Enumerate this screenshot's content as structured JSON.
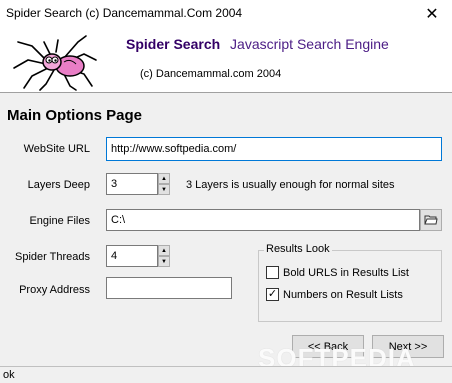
{
  "window": {
    "title": "Spider Search (c) Dancemammal.Com 2004"
  },
  "header": {
    "app_name": "Spider Search",
    "app_subtitle": "Javascript Search Engine",
    "copyright": "(c) Dancemammal.com 2004"
  },
  "page": {
    "title": "Main Options Page"
  },
  "form": {
    "website_url": {
      "label": "WebSite URL",
      "value": "http://www.softpedia.com/"
    },
    "layers_deep": {
      "label": "Layers Deep",
      "value": "3",
      "hint": "3 Layers is usually enough for normal sites"
    },
    "engine_files": {
      "label": "Engine Files",
      "value": "C:\\"
    },
    "spider_threads": {
      "label": "Spider Threads",
      "value": "4"
    },
    "proxy_address": {
      "label": "Proxy Address",
      "value": ""
    }
  },
  "results_look": {
    "title": "Results Look",
    "options": [
      {
        "label": "Bold URLS in Results List",
        "checked": false
      },
      {
        "label": "Numbers on Result Lists",
        "checked": true
      }
    ]
  },
  "nav": {
    "back_label": "<< Back",
    "next_label": "Next >>"
  },
  "watermark": "SOFTPEDIA",
  "status": {
    "text": "ok"
  },
  "colors": {
    "brand": "#330066",
    "subtitle": "#4b1c85",
    "panel": "#f0f0f0",
    "focus_border": "#0078d7"
  }
}
